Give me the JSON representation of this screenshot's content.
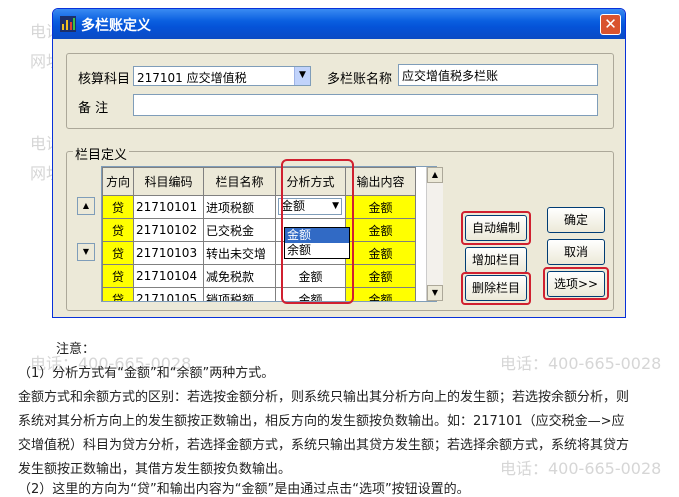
{
  "watermark": {
    "phone": "电话：400-665-0028",
    "site": "网址：www.chanjet.net"
  },
  "dialog": {
    "title": "多栏账定义",
    "close_glyph": "✕",
    "account_label": "核算科目",
    "account_value": "217101 应交增值税",
    "name_label": "多栏账名称",
    "name_value": "应交增值税多栏账",
    "remark_label": "备 注",
    "remark_value": "",
    "columns_group_label": "栏目定义"
  },
  "grid": {
    "headers": [
      "方向",
      "科目编码",
      "栏目名称",
      "分析方式",
      "输出内容"
    ],
    "rows": [
      {
        "dir": "贷",
        "code": "21710101",
        "name": "进项税额",
        "method": "金额",
        "output": "金额"
      },
      {
        "dir": "贷",
        "code": "21710102",
        "name": "已交税金",
        "method": "",
        "output": "金额"
      },
      {
        "dir": "贷",
        "code": "21710103",
        "name": "转出未交增",
        "method": "",
        "output": "金额"
      },
      {
        "dir": "贷",
        "code": "21710104",
        "name": "减免税款",
        "method": "金额",
        "output": "金额"
      },
      {
        "dir": "贷",
        "code": "21710105",
        "name": "销项税额",
        "method": "金额",
        "output": "金额"
      }
    ],
    "dropdown_options": [
      "金额",
      "余额"
    ]
  },
  "buttons": {
    "auto_edit": "自动编制",
    "add_column": "增加栏目",
    "delete_column": "删除栏目",
    "ok": "确定",
    "cancel": "取消",
    "options": "选项>>"
  },
  "notes": [
    "注意：",
    "（1）分析方式有“金额”和“余额”两种方式。",
    "金额方式和余额方式的区别：若选按金额分析，则系统只输出其分析方向上的发生额；若选按余额分析，则",
    "系统对其分析方向上的发生额按正数输出，相反方向的发生额按负数输出。如：217101（应交税金—>应",
    "交增值税）科目为贷方分析，若选择金额方式，系统只输出其贷方发生额；若选择余额方式，系统将其贷方",
    "发生额按正数输出，其借方发生额按负数输出。",
    "（2）这里的方向为“贷”和输出内容为“金额”是由通过点击“选项”按钮设置的。"
  ]
}
